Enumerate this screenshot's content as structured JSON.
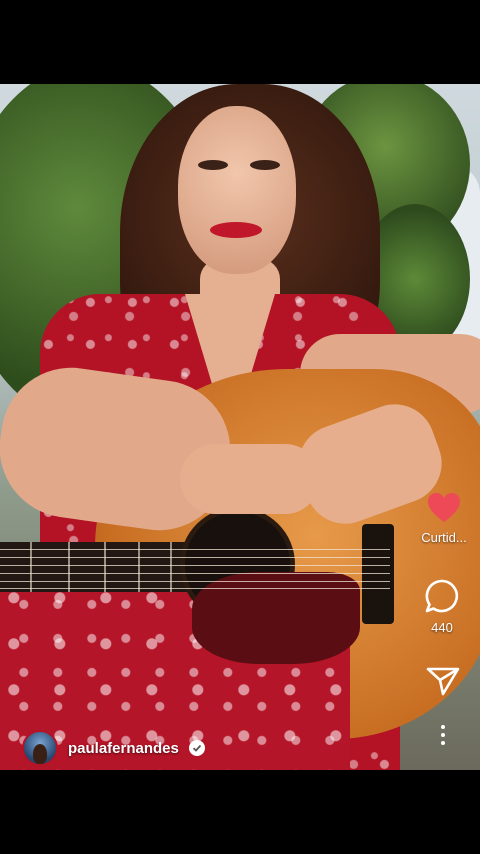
{
  "post": {
    "author": {
      "username": "paulafernandes",
      "verified": true
    },
    "likes_label": "Curtid...",
    "comments_count": "440"
  },
  "icons": {
    "like": "heart-icon",
    "comment": "comment-bubble-icon",
    "share": "paper-plane-icon",
    "more": "more-vertical-icon",
    "verified": "verified-check-icon"
  },
  "colors": {
    "like_active": "#ed4956",
    "background": "#000000"
  }
}
